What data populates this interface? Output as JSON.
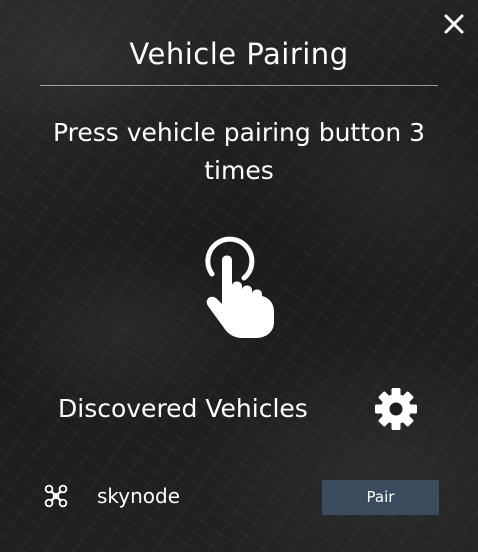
{
  "dialog": {
    "title": "Vehicle Pairing",
    "instruction": "Press vehicle pairing button 3 times",
    "close_icon": "close-icon",
    "instruction_icon": "tap-hand-icon"
  },
  "discovered": {
    "label": "Discovered Vehicles",
    "settings_icon": "gear-icon",
    "vehicles": [
      {
        "name": "skynode",
        "icon": "drone-icon",
        "action_label": "Pair"
      }
    ]
  },
  "colors": {
    "text": "#ffffff",
    "pair_button": "#3b4a5c"
  }
}
